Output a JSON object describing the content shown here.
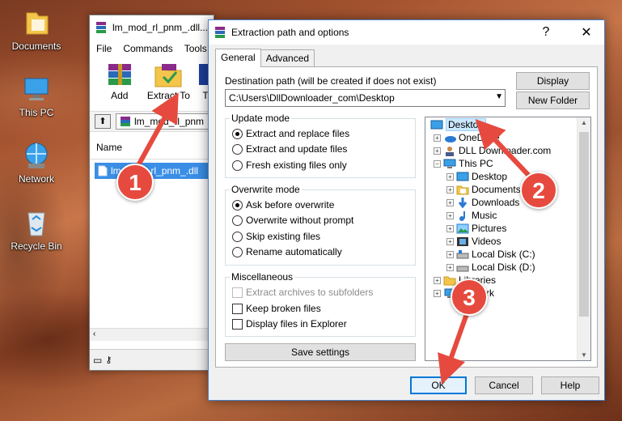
{
  "desktop": {
    "icons": [
      {
        "label": "Documents"
      },
      {
        "label": "This PC"
      },
      {
        "label": "Network"
      },
      {
        "label": "Recycle Bin"
      }
    ]
  },
  "rar_window": {
    "title": "lm_mod_rl_pnm_.dll...",
    "menu": [
      "File",
      "Commands",
      "Tools"
    ],
    "toolbar": [
      {
        "label": "Add"
      },
      {
        "label": "Extract To"
      },
      {
        "label": "T"
      }
    ],
    "path": "lm_mod_rl_pnm",
    "list_header": "Name",
    "file_name": "lm_mod_rl_pnm_.dll"
  },
  "dialog": {
    "title": "Extraction path and options",
    "help": "?",
    "close": "✕",
    "tabs": [
      {
        "label": "General"
      },
      {
        "label": "Advanced"
      }
    ],
    "dest_label": "Destination path (will be created if does not exist)",
    "dest_value": "C:\\Users\\DllDownloader_com\\Desktop",
    "display_btn": "Display",
    "new_folder_btn": "New Folder",
    "update_mode": {
      "title": "Update mode",
      "options": [
        "Extract and replace files",
        "Extract and update files",
        "Fresh existing files only"
      ],
      "selected": 0
    },
    "overwrite_mode": {
      "title": "Overwrite mode",
      "options": [
        "Ask before overwrite",
        "Overwrite without prompt",
        "Skip existing files",
        "Rename automatically"
      ],
      "selected": 0
    },
    "misc": {
      "title": "Miscellaneous",
      "options": [
        "Extract archives to subfolders",
        "Keep broken files",
        "Display files in Explorer"
      ]
    },
    "save_settings": "Save settings",
    "tree": [
      "Desktop",
      "OneDrive",
      "DLL Downloader.com",
      "This PC",
      "Desktop",
      "Documents",
      "Downloads",
      "Music",
      "Pictures",
      "Videos",
      "Local Disk (C:)",
      "Local Disk (D:)",
      "Libraries",
      "Network"
    ],
    "ok": "OK",
    "cancel": "Cancel",
    "helpbtn": "Help"
  },
  "annotations": [
    "1",
    "2",
    "3"
  ],
  "colors": {
    "arrow": "#e64a3f",
    "selection": "#cce8ff",
    "accent": "#4a7fc6"
  }
}
